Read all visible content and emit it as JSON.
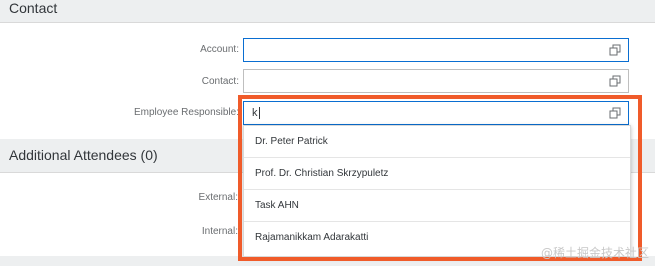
{
  "sections": {
    "contact": "Contact",
    "attendees": "Additional Attendees (0)"
  },
  "fields": {
    "account": {
      "label": "Account:",
      "value": ""
    },
    "contact": {
      "label": "Contact:",
      "value": ""
    },
    "employee_responsible": {
      "label": "Employee Responsible:",
      "value": "k"
    },
    "external": {
      "label": "External:"
    },
    "internal": {
      "label": "Internal:"
    }
  },
  "suggestions": [
    "Dr. Peter Patrick",
    "Prof. Dr. Christian Skrzypuletz",
    "Task AHN",
    "Rajamanikkam Adarakatti"
  ],
  "watermark": "@稀土掘金技术社区",
  "colors": {
    "highlight": "#f05b2a",
    "focus_border": "#0a6ed1",
    "section_bg": "#edeff0"
  },
  "icons": {
    "value_help": "value-help-icon"
  }
}
